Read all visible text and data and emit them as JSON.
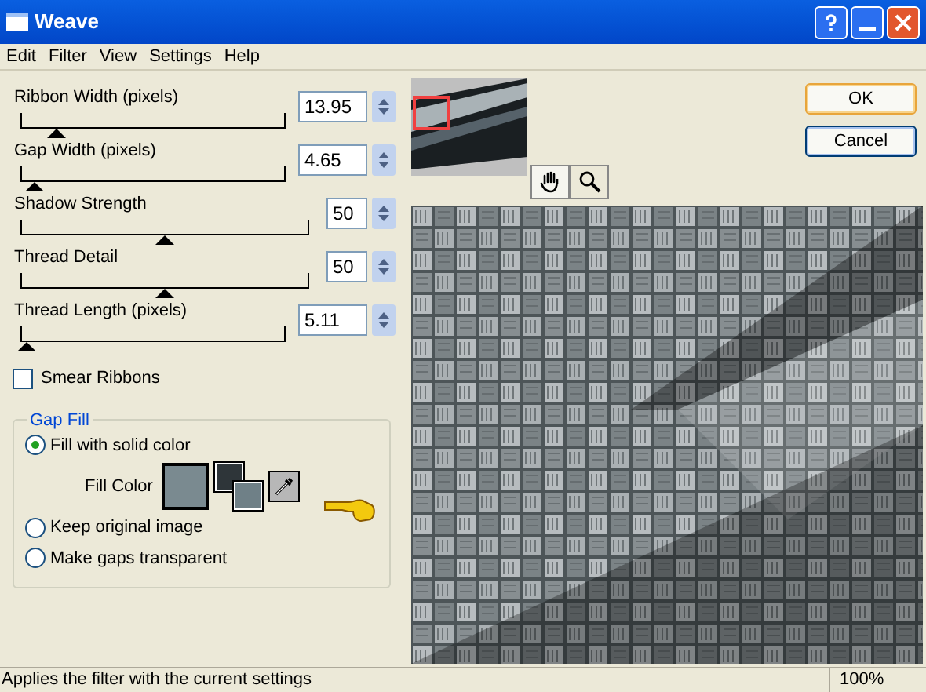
{
  "window": {
    "title": "Weave"
  },
  "menu": [
    "Edit",
    "Filter",
    "View",
    "Settings",
    "Help"
  ],
  "sliders": [
    {
      "label": "Ribbon Width (pixels)",
      "value": "13.95",
      "level": 0.13
    },
    {
      "label": "Gap Width (pixels)",
      "value": "4.65",
      "level": 0.05
    },
    {
      "label": "Shadow Strength",
      "value": "50",
      "level": 0.5
    },
    {
      "label": "Thread Detail",
      "value": "50",
      "level": 0.5
    },
    {
      "label": "Thread Length (pixels)",
      "value": "5.11",
      "level": 0.02
    }
  ],
  "smear": {
    "label": "Smear Ribbons",
    "checked": false
  },
  "gap_fill": {
    "title": "Gap Fill",
    "fill_color_label": "Fill Color",
    "color": "#7a8a90",
    "options": [
      {
        "label": "Fill with solid color",
        "selected": true
      },
      {
        "label": "Keep original image",
        "selected": false
      },
      {
        "label": "Make gaps transparent",
        "selected": false
      }
    ]
  },
  "buttons": [
    {
      "label": "OK",
      "default": true
    },
    {
      "label": "Cancel",
      "default": false
    }
  ],
  "status_bar": {
    "message": "Applies the filter with the current settings",
    "zoom": "100%"
  }
}
